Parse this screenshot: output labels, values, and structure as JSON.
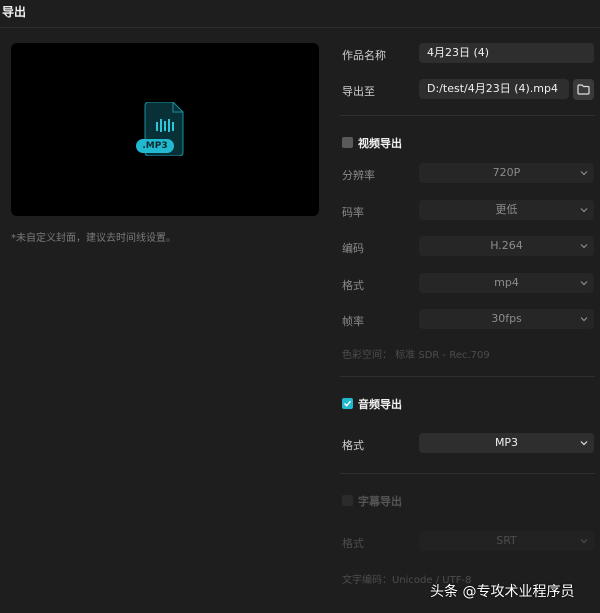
{
  "window": {
    "title": "导出"
  },
  "preview": {
    "file_badge": ".MP3",
    "note": "*未自定义封面，建议去时间线设置。"
  },
  "form": {
    "name_label": "作品名称",
    "name_value": "4月23日 (4)",
    "export_to_label": "导出至",
    "export_to_value": "D:/test/4月23日 (4).mp4"
  },
  "video_export": {
    "title": "视频导出",
    "checked": false,
    "resolution": {
      "label": "分辨率",
      "value": "720P"
    },
    "bitrate": {
      "label": "码率",
      "value": "更低"
    },
    "codec": {
      "label": "编码",
      "value": "H.264"
    },
    "format": {
      "label": "格式",
      "value": "mp4"
    },
    "framerate": {
      "label": "帧率",
      "value": "30fps"
    },
    "color_space": "色彩空间： 标准 SDR - Rec.709"
  },
  "audio_export": {
    "title": "音频导出",
    "checked": true,
    "format": {
      "label": "格式",
      "value": "MP3"
    }
  },
  "subtitle_export": {
    "title": "字幕导出",
    "checked": false,
    "format": {
      "label": "格式",
      "value": "SRT"
    },
    "encoding": "文字编码：Unicode / UTF-8"
  },
  "watermark": "头条 @专攻术业程序员",
  "colors": {
    "accent": "#20b9cf",
    "background": "#1e1e1e"
  },
  "icons": [
    "mp3-file-icon",
    "folder-icon",
    "chevron-down-icon",
    "checkmark-icon"
  ]
}
